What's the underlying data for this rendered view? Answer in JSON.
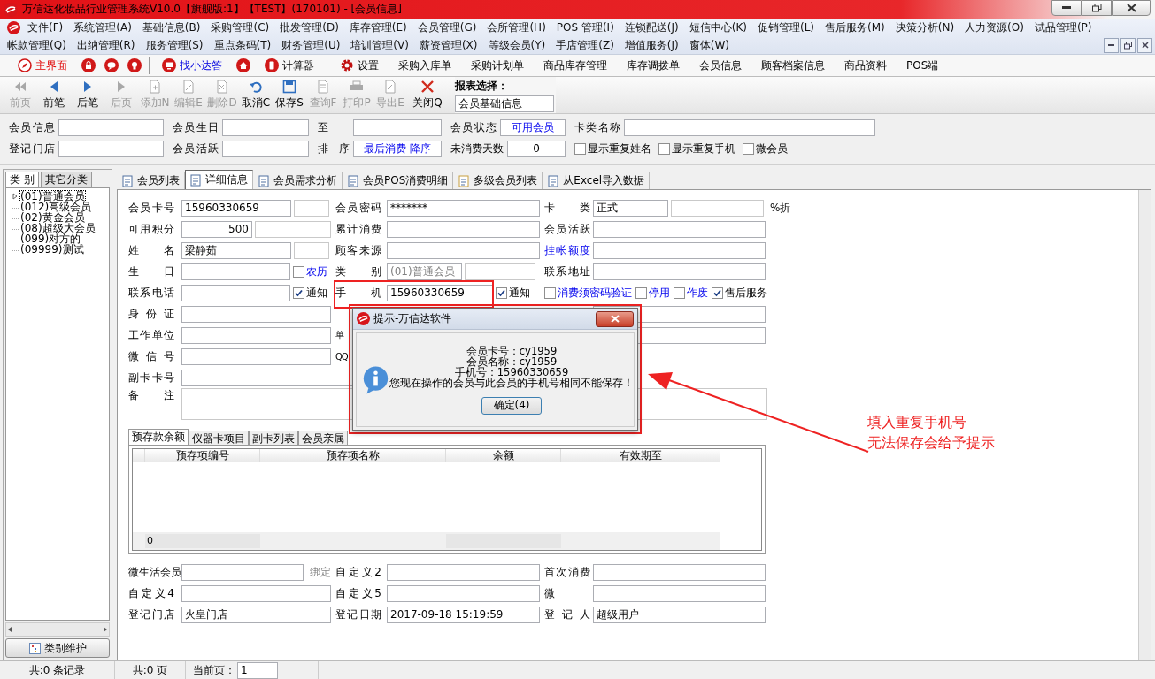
{
  "window": {
    "title": "万信达化妆品行业管理系统V10.0【旗舰版:1】【TEST】(170101) - [会员信息]"
  },
  "menu": {
    "rows": [
      [
        "文件(F)",
        "系统管理(A)",
        "基础信息(B)",
        "采购管理(C)",
        "批发管理(D)",
        "库存管理(E)",
        "会员管理(G)",
        "会所管理(H)",
        "POS 管理(I)",
        "连锁配送(J)",
        "短信中心(K)",
        "促销管理(L)",
        "售后服务(M)",
        "决策分析(N)",
        "人力资源(O)",
        "试品管理(P)"
      ],
      [
        "帐款管理(Q)",
        "出纳管理(R)",
        "服务管理(S)",
        "重点条码(T)",
        "财务管理(U)",
        "培训管理(V)",
        "薪资管理(X)",
        "等级会员(Y)",
        "手店管理(Z)",
        "增值服务(J)",
        "窗体(W)"
      ]
    ]
  },
  "quick_toolbar": {
    "groups": [
      [
        {
          "kind": "accent",
          "label": "主界面"
        },
        {
          "kind": "icon"
        },
        {
          "kind": "icon"
        },
        {
          "kind": "icon"
        }
      ],
      [
        {
          "kind": "link",
          "label": "找小达答"
        },
        {
          "kind": "icon"
        },
        {
          "kind": "plain",
          "label": "计算器"
        }
      ],
      [
        {
          "kind": "plain",
          "label": "设置"
        },
        {
          "kind": "plain",
          "label": "采购入库单"
        },
        {
          "kind": "plain",
          "label": "采购计划单"
        },
        {
          "kind": "plain",
          "label": "商品库存管理"
        },
        {
          "kind": "plain",
          "label": "库存调拨单"
        },
        {
          "kind": "plain",
          "label": "会员信息"
        },
        {
          "kind": "plain",
          "label": "顾客档案信息"
        },
        {
          "kind": "plain",
          "label": "商品资料"
        },
        {
          "kind": "plain",
          "label": "POS端"
        }
      ]
    ]
  },
  "toolbar": {
    "buttons": [
      {
        "label": "前页",
        "disabled": true
      },
      {
        "label": "前笔",
        "disabled": false
      },
      {
        "label": "后笔",
        "disabled": false
      },
      {
        "label": "后页",
        "disabled": true
      },
      {
        "label": "添加N",
        "disabled": true
      },
      {
        "label": "编辑E",
        "disabled": true
      },
      {
        "label": "删除D",
        "disabled": true
      },
      {
        "label": "取消C",
        "disabled": false
      },
      {
        "label": "保存S",
        "disabled": false
      },
      {
        "label": "查询F",
        "disabled": true
      },
      {
        "label": "打印P",
        "disabled": true
      },
      {
        "label": "导出E",
        "disabled": true
      },
      {
        "label": "关闭Q",
        "disabled": false
      }
    ],
    "report_select": {
      "label": "报表选择：",
      "value": "会员基础信息"
    }
  },
  "filters": {
    "rows": [
      [
        {
          "kind": "field",
          "label": "会员信息"
        },
        {
          "kind": "field",
          "label": "会员生日"
        },
        {
          "kind": "field",
          "label": "至"
        },
        {
          "kind": "choice",
          "label": "会员状态",
          "value": "可用会员"
        },
        {
          "kind": "field",
          "label": "卡类名称"
        }
      ],
      [
        {
          "kind": "field",
          "label": "登记门店"
        },
        {
          "kind": "field",
          "label": "会员活跃"
        },
        {
          "kind": "choice",
          "label": "排 序",
          "value": "最后消费-降序"
        },
        {
          "kind": "number",
          "label": "未消费天数",
          "value": "0"
        },
        {
          "kind": "checks",
          "items": [
            {
              "label": "显示重复姓名",
              "checked": false
            },
            {
              "label": "显示重复手机",
              "checked": false
            },
            {
              "label": "微会员",
              "checked": false
            }
          ]
        }
      ]
    ]
  },
  "category_panel": {
    "tabs": [
      {
        "label": "类 别",
        "selected": true
      },
      {
        "label": "其它分类",
        "selected": false
      }
    ],
    "tree": [
      {
        "label": "(01)普通会员",
        "selected": true,
        "expandable": true
      },
      {
        "label": "(012)高级会员",
        "selected": false,
        "expandable": false
      },
      {
        "label": "(02)黄金会员",
        "selected": false,
        "expandable": false
      },
      {
        "label": "(08)超级大会员",
        "selected": false,
        "expandable": false
      },
      {
        "label": "(099)对方的",
        "selected": false,
        "expandable": false
      },
      {
        "label": "(09999)测试",
        "selected": false,
        "expandable": false
      }
    ],
    "button": "类别维护"
  },
  "main_tabs": [
    {
      "label": "会员列表",
      "selected": false
    },
    {
      "label": "详细信息",
      "selected": true
    },
    {
      "label": "会员需求分析",
      "selected": false
    },
    {
      "label": "会员POS消费明细",
      "selected": false
    },
    {
      "label": "多级会员列表",
      "selected": false
    },
    {
      "label": "从Excel导入数据",
      "selected": false
    }
  ],
  "detail_form": {
    "rows": [
      [
        {
          "kind": "field",
          "label": "会员卡号",
          "value": "15960330659",
          "split": true
        },
        {
          "kind": "field",
          "label": "会员密码",
          "value": "*******"
        },
        {
          "kind": "field",
          "label": "卡 类",
          "value": "正式",
          "split": true,
          "suffix": "%折"
        }
      ],
      [
        {
          "kind": "number-field",
          "label": "可用积分",
          "value": "500",
          "split": true
        },
        {
          "kind": "field",
          "label": "累计消费"
        },
        {
          "kind": "field",
          "label": "会员活跃"
        }
      ],
      [
        {
          "kind": "field",
          "label": "姓 名",
          "value": "梁静茹",
          "split": true
        },
        {
          "kind": "field",
          "label": "顾客来源"
        },
        {
          "kind": "field",
          "label": "挂帐额度",
          "link": true
        }
      ],
      [
        {
          "kind": "field",
          "label": "生 日",
          "check": {
            "label": "农历",
            "checked": false,
            "link": true
          }
        },
        {
          "kind": "field",
          "label": "类 别",
          "value": "(01)普通会员",
          "split": true,
          "disabled": true
        },
        {
          "kind": "field",
          "label": "联系地址"
        }
      ],
      [
        {
          "kind": "field",
          "label": "联系电话",
          "check": {
            "label": "通知",
            "checked": true,
            "link": false
          }
        },
        {
          "kind": "field",
          "label": "手 机",
          "value": "15960330659",
          "check": {
            "label": "通知",
            "checked": true,
            "link": false
          }
        },
        {
          "kind": "checks",
          "items": [
            {
              "label": "消费须密码验证",
              "checked": false,
              "link": true
            },
            {
              "label": "停用",
              "checked": false,
              "link": true
            },
            {
              "label": "作废",
              "checked": false,
              "link": true
            },
            {
              "label": "售后服务",
              "checked": true,
              "link": false
            }
          ]
        }
      ],
      [
        {
          "kind": "field",
          "label": "身 份 证"
        },
        {
          "kind": "blank"
        },
        {
          "kind": "field"
        }
      ],
      [
        {
          "kind": "field",
          "label": "工作单位"
        },
        {
          "kind": "label",
          "label": "单"
        },
        {
          "kind": "field"
        }
      ],
      [
        {
          "kind": "field",
          "label": "微 信 号"
        },
        {
          "kind": "label",
          "label": "QQ"
        },
        {
          "kind": "blank"
        }
      ],
      [
        {
          "kind": "wide-field",
          "label": "副卡卡号"
        }
      ],
      [
        {
          "kind": "note-field",
          "label": "备 注"
        }
      ]
    ]
  },
  "sub_tabs": [
    {
      "label": "预存款余额",
      "selected": true
    },
    {
      "label": "仪器卡项目",
      "selected": false
    },
    {
      "label": "副卡列表",
      "selected": false
    },
    {
      "label": "会员亲属",
      "selected": false
    }
  ],
  "sub_table": {
    "columns": [
      "预存项编号",
      "预存项名称",
      "余额",
      "有效期至"
    ],
    "footer": [
      "0"
    ]
  },
  "extra_form": {
    "rows": [
      [
        {
          "kind": "field",
          "label": "微生活会员",
          "action": "绑定"
        },
        {
          "kind": "field",
          "label": "自定义2"
        },
        {
          "kind": "field",
          "label": "首次消费"
        }
      ],
      [
        {
          "kind": "field",
          "label": "自定义4"
        },
        {
          "kind": "field",
          "label": "自定义5"
        },
        {
          "kind": "field",
          "label": "微"
        }
      ],
      [
        {
          "kind": "field",
          "label": "登记门店",
          "value": "火皇门店"
        },
        {
          "kind": "field",
          "label": "登记日期",
          "value": "2017-09-18 15:19:59"
        },
        {
          "kind": "field",
          "label": "登 记 人",
          "value": "超级用户"
        }
      ]
    ]
  },
  "dialog": {
    "title": "提示-万信达软件",
    "lines": [
      "会员卡号：cy1959",
      "会员名称：cy1959",
      "手机号：15960330659",
      "您现在操作的会员与此会员的手机号相同不能保存！"
    ],
    "button": "确定(4)"
  },
  "annotation": {
    "lines": [
      "填入重复手机号",
      "无法保存会给予提示"
    ]
  },
  "status_bar": {
    "records": "共:0 条记录",
    "pages": "共:0 页",
    "page_label": "当前页：",
    "page_value": "1"
  }
}
